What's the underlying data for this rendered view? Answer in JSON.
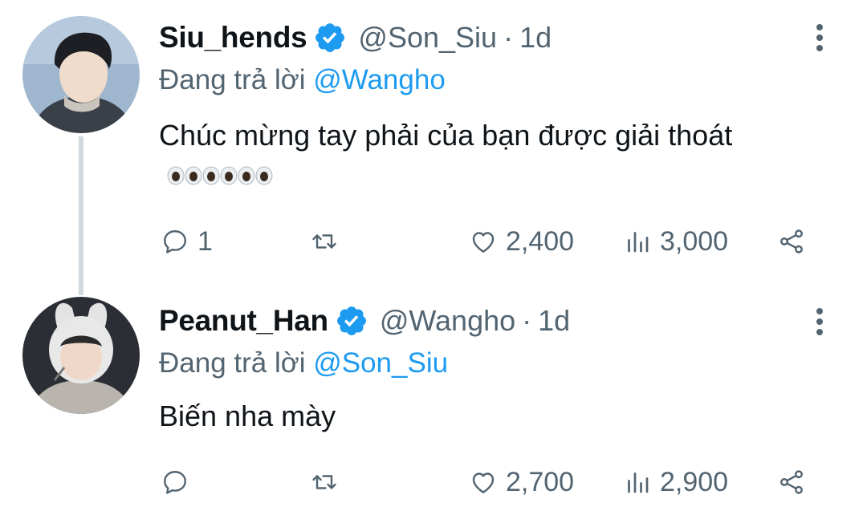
{
  "tweets": [
    {
      "name": "Siu_hends",
      "handle": "@Son_Siu",
      "separator": "·",
      "time": "1d",
      "reply_prefix": "Đang trả lời",
      "reply_to": "@Wangho",
      "text": "Chúc mừng tay phải của bạn được giải thoát",
      "emoji": "👀👀👀",
      "replies": "1",
      "retweets": "",
      "likes": "2,400",
      "views": "3,000"
    },
    {
      "name": "Peanut_Han",
      "handle": "@Wangho",
      "separator": "·",
      "time": "1d",
      "reply_prefix": "Đang trả lời",
      "reply_to": "@Son_Siu",
      "text": "Biến nha mày",
      "replies": "",
      "retweets": "",
      "likes": "2,700",
      "views": "2,900"
    }
  ],
  "colors": {
    "accent": "#1d9bf0",
    "secondary_text": "#536471",
    "primary_text": "#0f1419",
    "thread_line": "#cfd9de"
  },
  "icons": [
    "verified-badge-icon",
    "more-options-icon",
    "reply-icon",
    "retweet-icon",
    "like-icon",
    "views-icon",
    "share-icon"
  ]
}
